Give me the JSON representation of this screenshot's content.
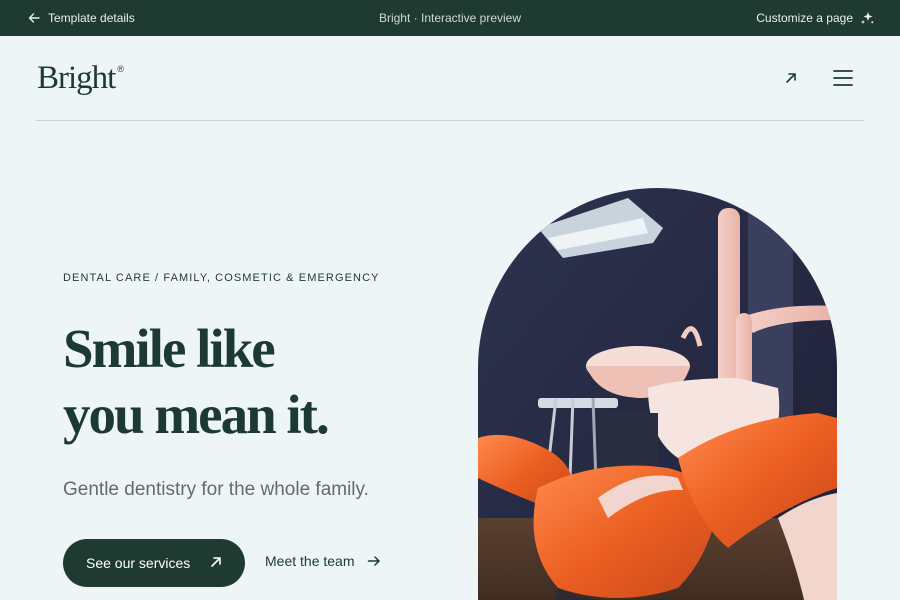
{
  "topbar": {
    "back_label": "Template details",
    "center_label": "Bright · Interactive preview",
    "customize_label": "Customize a page"
  },
  "header": {
    "logo_text": "Bright",
    "logo_mark": "®",
    "icons": [
      "arrow-up-right-icon",
      "menu-icon"
    ]
  },
  "hero": {
    "eyebrow": "DENTAL CARE / FAMILY, COSMETIC & EMERGENCY",
    "headline_line1": "Smile like",
    "headline_line2": "you mean it.",
    "subtitle": "Gentle dentistry for the whole family.",
    "primary_button": "See our services",
    "secondary_link": "Meet the team"
  },
  "colors": {
    "topbar_bg": "#1f3a30",
    "page_bg": "#eef5f6",
    "text": "#1c3a33",
    "button_bg": "#1f3a30",
    "chair_orange": "#ef6a2c"
  }
}
